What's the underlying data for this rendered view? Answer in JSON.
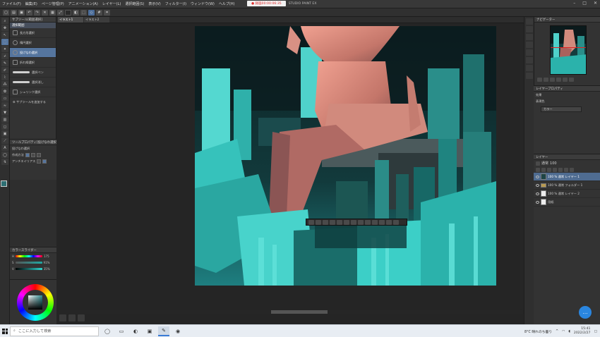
{
  "menu": {
    "items": [
      "ファイル(F)",
      "編集(E)",
      "ページ管理(P)",
      "アニメーション(A)",
      "レイヤー(L)",
      "選択範囲(S)",
      "表示(V)",
      "フィルター(I)",
      "ウィンドウ(W)",
      "ヘルプ(H)"
    ],
    "title_tab": "● 録画00:00:06:35",
    "app_name": "STUDIO PAINT EX"
  },
  "subtool": {
    "header": "サブツール[範囲選択]",
    "tab": "選択範囲",
    "items": [
      {
        "label": "長方形選択",
        "kind": "rect"
      },
      {
        "label": "楕円選択",
        "kind": "round"
      },
      {
        "label": "投げなわ選択",
        "kind": "lasso",
        "selected": true
      },
      {
        "label": "折れ線選択",
        "kind": "poly"
      },
      {
        "label": "選択ペン",
        "kind": "stroke"
      },
      {
        "label": "選択消し",
        "kind": "stroke"
      },
      {
        "label": "シュリンク選択",
        "kind": "rect"
      }
    ],
    "add_label": "サブツールを追加する"
  },
  "tool_property": {
    "header": "ツールプロパティ[投げなわ選択]",
    "mode_label": "投げなわ選択",
    "row1": "作成方法",
    "row2": "アンチエイリアス"
  },
  "color_slider": {
    "header": "カラースライダー",
    "rows": [
      {
        "label": "H",
        "value": "175"
      },
      {
        "label": "S",
        "value": "91%"
      },
      {
        "label": "V",
        "value": "35%"
      }
    ]
  },
  "canvas": {
    "tabs": [
      "イラスト1",
      "イラスト2"
    ]
  },
  "navigator": {
    "header": "ナビゲーター"
  },
  "layer_property": {
    "header": "レイヤープロパティ",
    "effect_label": "効果",
    "expression_label": "表現色",
    "expression_value": "カラー"
  },
  "layers": {
    "header": "レイヤー",
    "blend": "通常",
    "opacity": "100",
    "rows": [
      {
        "name": "100 % 通常 レイヤー 1",
        "thumb": "dark",
        "selected": true
      },
      {
        "name": "100 % 通常 フォルダー 1",
        "thumb": "folder",
        "selected": false
      },
      {
        "name": "100 % 通常 レイヤー 2",
        "thumb": "white",
        "selected": false
      },
      {
        "name": "用紙",
        "thumb": "white",
        "selected": false
      }
    ]
  },
  "taskbar": {
    "search_placeholder": "ここに入力して検索",
    "weather": "8°C 晴れのち曇り",
    "time": "15:41",
    "date": "2022/2/27"
  }
}
